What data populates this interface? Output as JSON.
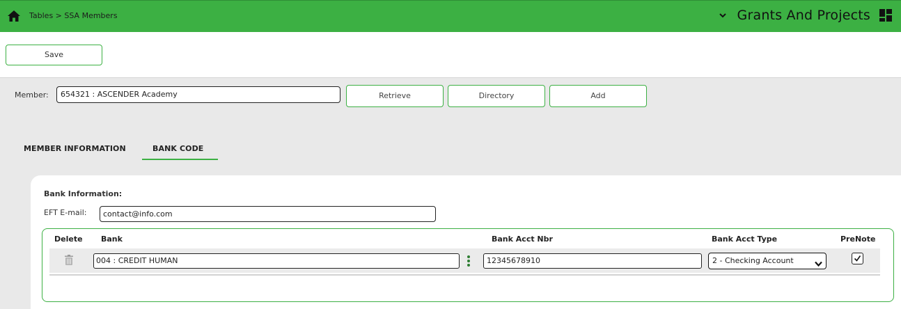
{
  "header": {
    "breadcrumb": "Tables > SSA Members",
    "app_title": "Grants And Projects",
    "icons": [
      "home-icon",
      "chevron-down-icon",
      "dashboard-grid-icon"
    ],
    "bar_color": "#3cb043"
  },
  "toolbar": {
    "save_label": "Save"
  },
  "member": {
    "label": "Member:",
    "value": "654321 : ASCENDER Academy",
    "retrieve_label": "Retrieve",
    "directory_label": "Directory",
    "add_label": "Add"
  },
  "tabs": [
    {
      "label": "MEMBER INFORMATION",
      "active": false
    },
    {
      "label": "BANK CODE",
      "active": true
    }
  ],
  "bank_info": {
    "section_label": "Bank Information:",
    "eft_label": "EFT E-mail:",
    "eft_value": "contact@info.com"
  },
  "grid": {
    "columns": {
      "delete": "Delete",
      "bank": "Bank",
      "acct_nbr": "Bank Acct Nbr",
      "acct_type": "Bank Acct Type",
      "prenote": "PreNote"
    },
    "rows": [
      {
        "bank": "004 : CREDIT HUMAN",
        "acct_nbr": "12345678910",
        "acct_type": "2 - Checking Account",
        "prenote": true
      }
    ]
  }
}
